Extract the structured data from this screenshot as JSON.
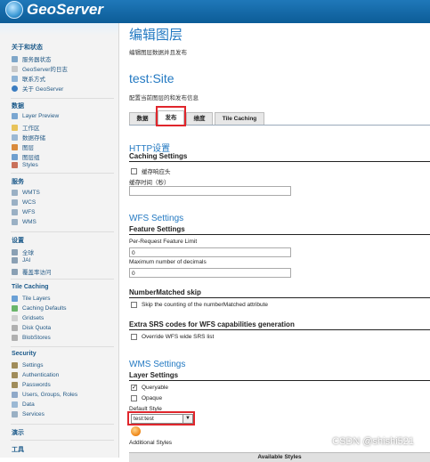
{
  "app": {
    "name": "GeoServer"
  },
  "sidebar": {
    "sections": [
      {
        "title": "关于和状态",
        "items": [
          "服务器状态",
          "GeoServer的日志",
          "联系方式",
          "关于 GeoServer"
        ]
      },
      {
        "title": "数据",
        "items": [
          "Layer Preview",
          "工作区",
          "数据存储",
          "图层",
          "图层组",
          "Styles"
        ]
      },
      {
        "title": "服务",
        "items": [
          "WMTS",
          "WCS",
          "WFS",
          "WMS"
        ]
      },
      {
        "title": "设置",
        "items": [
          "全球",
          "JAI",
          "覆盖率访问"
        ]
      },
      {
        "title": "Tile Caching",
        "items": [
          "Tile Layers",
          "Caching Defaults",
          "Gridsets",
          "Disk Quota",
          "BlobStores"
        ]
      },
      {
        "title": "Security",
        "items": [
          "Settings",
          "Authentication",
          "Passwords",
          "Users, Groups, Roles",
          "Data",
          "Services"
        ]
      },
      {
        "title": "演示",
        "items": []
      },
      {
        "title": "工具",
        "items": []
      }
    ]
  },
  "main": {
    "title": "编辑图层",
    "subtitle": "编辑图层数据并且发布",
    "layer_name": "test:Site",
    "layer_desc": "配置当前图层的和发布信息",
    "tabs": [
      "数据",
      "发布",
      "维度",
      "Tile Caching"
    ],
    "active_tab": "发布",
    "http": {
      "heading": "HTTP设置",
      "subheading": "Caching Settings",
      "cache_headers_label": "缓存响应头",
      "cache_time_label": "缓存时间（秒）",
      "cache_time_value": ""
    },
    "wfs": {
      "heading": "WFS Settings",
      "subheading": "Feature Settings",
      "per_request_label": "Per-Request Feature Limit",
      "per_request_value": "0",
      "max_decimals_label": "Maximum number of decimals",
      "max_decimals_value": "0"
    },
    "numbermatched": {
      "heading": "NumberMatched skip",
      "label": "Skip the counting of the numberMatched attribute"
    },
    "srs": {
      "heading": "Extra SRS codes for WFS capabilities generation",
      "label": "Override WFS wide SRS list"
    },
    "wms": {
      "heading": "WMS Settings",
      "subheading": "Layer Settings",
      "queryable_label": "Queryable",
      "queryable_checked": true,
      "opaque_label": "Opaque",
      "default_style_label": "Default Style",
      "default_style_value": "test:test",
      "additional_styles_label": "Additional Styles",
      "available_styles_header": "Available Styles"
    }
  },
  "watermark": "CSDN @shishi521",
  "colors": {
    "header": "#1f78b9",
    "title": "#2379c2",
    "highlight": "#e0262c"
  }
}
